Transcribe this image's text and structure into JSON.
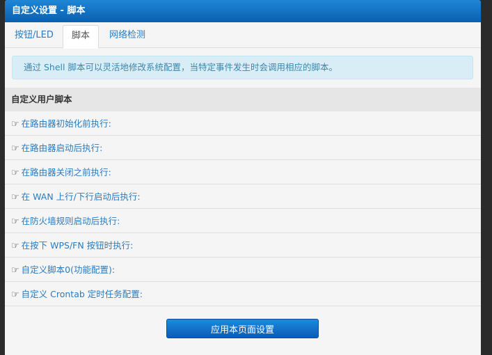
{
  "header": {
    "title": "自定义设置 - 脚本"
  },
  "tabs": [
    {
      "label": "按钮/LED"
    },
    {
      "label": "脚本"
    },
    {
      "label": "网络检测"
    }
  ],
  "info": {
    "text": "通过 Shell 脚本可以灵活地修改系统配置，当特定事件发生时会调用相应的脚本。"
  },
  "section": {
    "title": "自定义用户脚本"
  },
  "scripts": [
    {
      "label": "在路由器初始化前执行:"
    },
    {
      "label": "在路由器启动后执行:"
    },
    {
      "label": "在路由器关闭之前执行:"
    },
    {
      "label": "在 WAN 上行/下行启动后执行:"
    },
    {
      "label": "在防火墙规则启动后执行:"
    },
    {
      "label": "在按下 WPS/FN 按钮时执行:"
    },
    {
      "label": "自定义脚本0(功能配置):"
    },
    {
      "label": "自定义 Crontab 定时任务配置:"
    }
  ],
  "actions": {
    "apply_label": "应用本页面设置"
  },
  "icons": {
    "row_icon": "pointing-hand-icon"
  },
  "colors": {
    "header_blue": "#0a5fb0",
    "link_blue": "#2a7bbf",
    "info_bg": "#d9edf7"
  }
}
